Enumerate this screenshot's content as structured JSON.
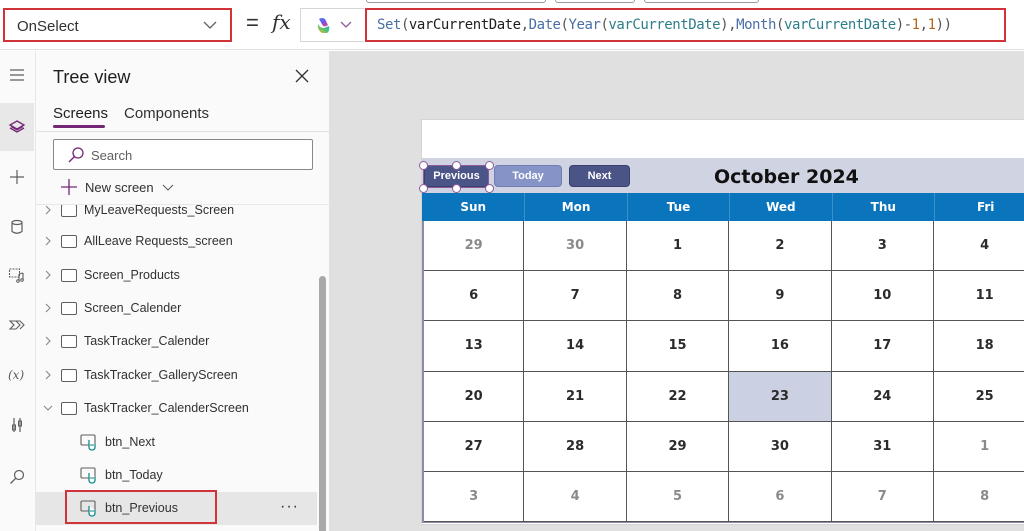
{
  "formula_bar": {
    "property": "OnSelect",
    "equals": "=",
    "fx": "fx",
    "formula_tokens": [
      {
        "t": "Set",
        "c": "c-fn"
      },
      {
        "t": "(",
        "c": "c-p"
      },
      {
        "t": "varCurrentDate",
        "c": "c-var"
      },
      {
        "t": ",",
        "c": "c-p"
      },
      {
        "t": "Date",
        "c": "c-fn"
      },
      {
        "t": "(",
        "c": "c-p"
      },
      {
        "t": "Year",
        "c": "c-fn"
      },
      {
        "t": "(",
        "c": "c-p"
      },
      {
        "t": "varCurrentDate",
        "c": "c-arg"
      },
      {
        "t": "),",
        "c": "c-p"
      },
      {
        "t": "Month",
        "c": "c-fn"
      },
      {
        "t": "(",
        "c": "c-p"
      },
      {
        "t": "varCurrentDate",
        "c": "c-arg"
      },
      {
        "t": ")",
        "c": "c-p"
      },
      {
        "t": "-",
        "c": "c-op"
      },
      {
        "t": "1",
        "c": "c-num"
      },
      {
        "t": ",",
        "c": "c-p"
      },
      {
        "t": "1",
        "c": "c-num"
      },
      {
        "t": "))",
        "c": "c-p"
      }
    ],
    "formula_text": "Set(varCurrentDate,Date(Year(varCurrentDate),Month(varCurrentDate)-1,1))"
  },
  "rail": {
    "items": [
      {
        "icon": "hamburger-menu-icon"
      },
      {
        "icon": "layers-icon",
        "active": true
      },
      {
        "icon": "plus-icon"
      },
      {
        "icon": "database-icon"
      },
      {
        "icon": "media-icon"
      },
      {
        "icon": "power-automate-icon"
      },
      {
        "icon": "variables-icon"
      },
      {
        "icon": "advanced-tools-icon"
      },
      {
        "icon": "search-icon"
      }
    ]
  },
  "tree_view": {
    "title": "Tree view",
    "tabs": [
      {
        "label": "Screens",
        "active": true
      },
      {
        "label": "Components",
        "active": false
      }
    ],
    "search_placeholder": "Search",
    "new_screen_label": "New screen",
    "nodes": [
      {
        "label": "MyLeaveRequests_Screen",
        "type": "screen",
        "expanded": false
      },
      {
        "label": "AllLeave Requests_screen",
        "type": "screen",
        "expanded": false
      },
      {
        "label": "Screen_Products",
        "type": "screen",
        "expanded": false
      },
      {
        "label": "Screen_Calender",
        "type": "screen",
        "expanded": false
      },
      {
        "label": "TaskTracker_Calender",
        "type": "screen",
        "expanded": false
      },
      {
        "label": "TaskTracker_GalleryScreen",
        "type": "screen",
        "expanded": false
      },
      {
        "label": "TaskTracker_CalenderScreen",
        "type": "screen",
        "expanded": true
      },
      {
        "label": "btn_Next",
        "type": "button",
        "selected": false
      },
      {
        "label": "btn_Today",
        "type": "button",
        "selected": false
      },
      {
        "label": "btn_Previous",
        "type": "button",
        "selected": true
      }
    ],
    "more_label": "···"
  },
  "calendar": {
    "buttons": {
      "previous": "Previous",
      "today": "Today",
      "next": "Next"
    },
    "month_title": "October 2024",
    "weekdays": [
      "Sun",
      "Mon",
      "Tue",
      "Wed",
      "Thu",
      "Fri"
    ],
    "weeks": [
      [
        {
          "d": "29",
          "m": true
        },
        {
          "d": "30",
          "m": true
        },
        {
          "d": "1"
        },
        {
          "d": "2"
        },
        {
          "d": "3"
        },
        {
          "d": "4"
        }
      ],
      [
        {
          "d": "6"
        },
        {
          "d": "7"
        },
        {
          "d": "8"
        },
        {
          "d": "9"
        },
        {
          "d": "10"
        },
        {
          "d": "11"
        }
      ],
      [
        {
          "d": "13"
        },
        {
          "d": "14"
        },
        {
          "d": "15"
        },
        {
          "d": "16"
        },
        {
          "d": "17"
        },
        {
          "d": "18"
        }
      ],
      [
        {
          "d": "20"
        },
        {
          "d": "21"
        },
        {
          "d": "22"
        },
        {
          "d": "23",
          "today": true
        },
        {
          "d": "24"
        },
        {
          "d": "25"
        }
      ],
      [
        {
          "d": "27"
        },
        {
          "d": "28"
        },
        {
          "d": "29"
        },
        {
          "d": "30"
        },
        {
          "d": "31"
        },
        {
          "d": "1",
          "m": true
        }
      ],
      [
        {
          "d": "3",
          "m": true
        },
        {
          "d": "4",
          "m": true
        },
        {
          "d": "5",
          "m": true
        },
        {
          "d": "6",
          "m": true
        },
        {
          "d": "7",
          "m": true
        },
        {
          "d": "8",
          "m": true
        }
      ]
    ],
    "colors": {
      "header_band": "#cfd3e2",
      "weekday_bar": "#0a74bd",
      "button_dark": "#4a5486",
      "button_light": "#8593c6",
      "today_cell": "#cbd0e2",
      "selection_outline": "#d13438",
      "accent": "#742774"
    }
  }
}
